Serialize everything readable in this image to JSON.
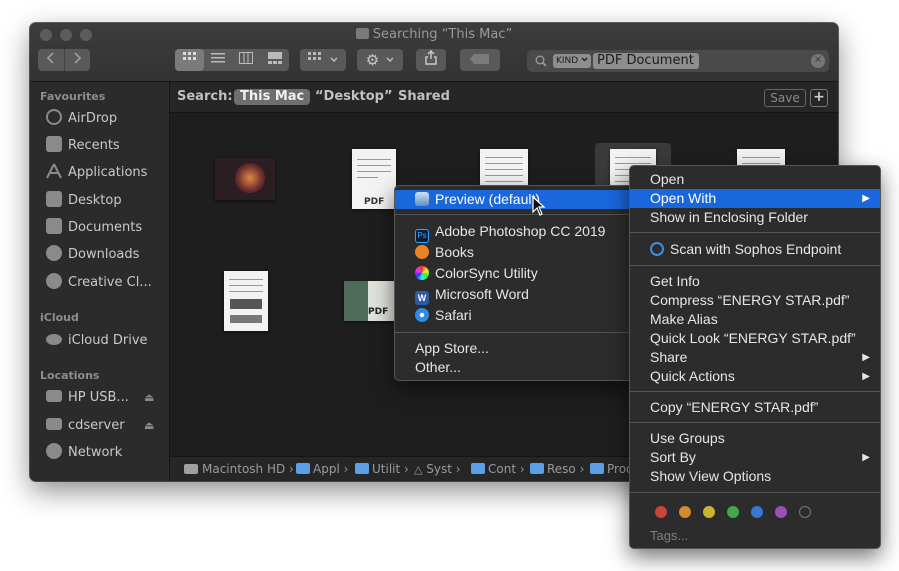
{
  "window": {
    "title": "Searching “This Mac”"
  },
  "toolbar": {
    "back_icon": "chevron-left-icon",
    "forward_icon": "chevron-right-icon",
    "search": {
      "kind_label": "KIND",
      "kind_value": "PDF Document"
    }
  },
  "sidebar": {
    "favourites_header": "Favourites",
    "favourites": [
      "AirDrop",
      "Recents",
      "Applications",
      "Desktop",
      "Documents",
      "Downloads",
      "Creative Cl..."
    ],
    "icloud_header": "iCloud",
    "icloud": [
      "iCloud Drive"
    ],
    "locations_header": "Locations",
    "locations": [
      "HP USB...",
      "cdserver",
      "Network"
    ]
  },
  "scope": {
    "label": "Search:",
    "options": [
      "This Mac",
      "“Desktop”",
      "Shared"
    ],
    "save": "Save",
    "add": "+"
  },
  "files": {
    "pdf_label": "PDF"
  },
  "pathbar": [
    "Macintosh HD",
    "Appl",
    "Utilit",
    "Syst",
    "Cont",
    "Reso",
    "Prod"
  ],
  "open_with_menu": {
    "default": "Preview (default)",
    "apps": [
      "Adobe Photoshop CC 2019",
      "Books",
      "ColorSync Utility",
      "Microsoft Word",
      "Safari"
    ],
    "more": [
      "App Store...",
      "Other..."
    ]
  },
  "context_menu": {
    "open": "Open",
    "open_with": "Open With",
    "show_enclosing": "Show in Enclosing Folder",
    "scan": "Scan with Sophos Endpoint",
    "get_info": "Get Info",
    "compress": "Compress “ENERGY STAR.pdf”",
    "make_alias": "Make Alias",
    "quick_look": "Quick Look “ENERGY STAR.pdf”",
    "share": "Share",
    "quick_actions": "Quick Actions",
    "copy": "Copy “ENERGY STAR.pdf”",
    "use_groups": "Use Groups",
    "sort_by": "Sort By",
    "show_view_options": "Show View Options",
    "tags_label": "Tags...",
    "tag_colors": [
      "#c9443b",
      "#d68a2e",
      "#c9b330",
      "#41a84b",
      "#3579d1",
      "#9b4fb8"
    ]
  },
  "colors": {
    "highlight": "#1a66db",
    "window_bg": "#1e1e1e",
    "sidebar_bg": "#2b2b2b"
  }
}
